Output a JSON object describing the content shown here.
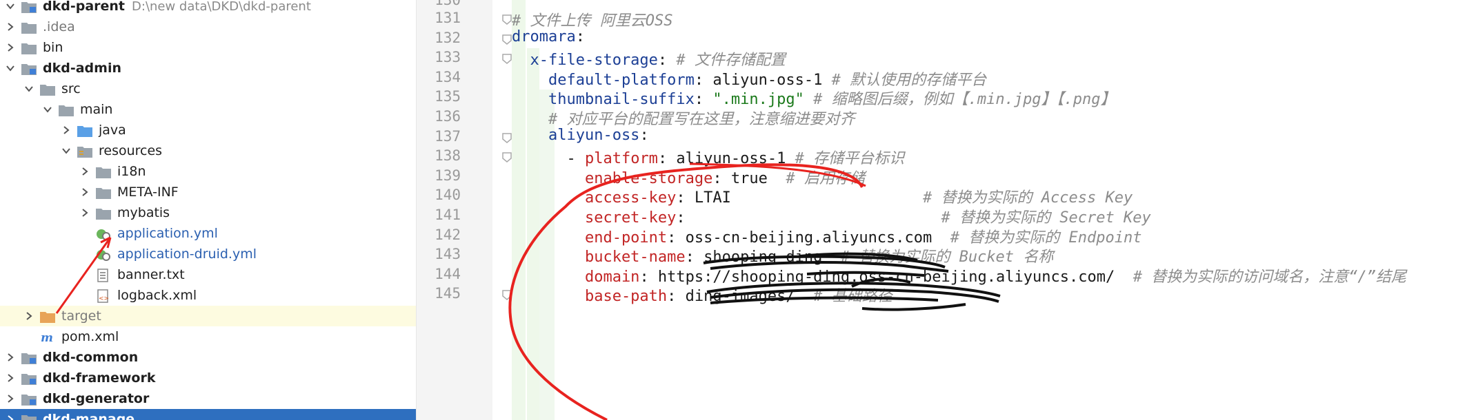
{
  "tree": {
    "root_label": "dkd-parent",
    "root_path": "D:\\new data\\DKD\\dkd-parent",
    "items": [
      {
        "label": ".idea"
      },
      {
        "label": "bin"
      },
      {
        "label": "dkd-admin"
      },
      {
        "label": "src"
      },
      {
        "label": "main"
      },
      {
        "label": "java"
      },
      {
        "label": "resources"
      },
      {
        "label": "i18n"
      },
      {
        "label": "META-INF"
      },
      {
        "label": "mybatis"
      },
      {
        "label": "application.yml"
      },
      {
        "label": "application-druid.yml"
      },
      {
        "label": "banner.txt"
      },
      {
        "label": "logback.xml"
      },
      {
        "label": "target"
      },
      {
        "label": "pom.xml"
      },
      {
        "label": "dkd-common"
      },
      {
        "label": "dkd-framework"
      },
      {
        "label": "dkd-generator"
      },
      {
        "label": "dkd-manage"
      }
    ]
  },
  "editor": {
    "partial_top_line": "130",
    "lines": [
      {
        "n": "131",
        "p": [
          {
            "t": "# 文件上传 阿里云OSS",
            "c": "cmt"
          }
        ]
      },
      {
        "n": "132",
        "p": [
          {
            "t": "dromara",
            "c": "navy"
          },
          {
            "t": ":",
            "c": ""
          }
        ]
      },
      {
        "n": "133",
        "p": [
          {
            "t": "  x-file-storage",
            "c": "navy"
          },
          {
            "t": ": ",
            "c": ""
          },
          {
            "t": "# 文件存储配置",
            "c": "cmt"
          }
        ]
      },
      {
        "n": "134",
        "p": [
          {
            "t": "    default-platform",
            "c": "navy"
          },
          {
            "t": ": aliyun-oss-1 ",
            "c": ""
          },
          {
            "t": "# 默认使用的存储平台",
            "c": "cmt"
          }
        ]
      },
      {
        "n": "135",
        "p": [
          {
            "t": "    thumbnail-suffix",
            "c": "navy"
          },
          {
            "t": ": ",
            "c": ""
          },
          {
            "t": "\".min.jpg\"",
            "c": "green"
          },
          {
            "t": " # 缩略图后缀，例如【.min.jpg】【.png】",
            "c": "cmt"
          }
        ]
      },
      {
        "n": "136",
        "p": [
          {
            "t": "    # 对应平台的配置写在这里，注意缩进要对齐",
            "c": "cmt"
          }
        ]
      },
      {
        "n": "137",
        "p": [
          {
            "t": "    aliyun-oss",
            "c": "navy"
          },
          {
            "t": ":",
            "c": ""
          }
        ]
      },
      {
        "n": "138",
        "p": [
          {
            "t": "      - ",
            "c": ""
          },
          {
            "t": "platform",
            "c": "red"
          },
          {
            "t": ": aliyun-oss-1 ",
            "c": ""
          },
          {
            "t": "# 存储平台标识",
            "c": "cmt"
          }
        ]
      },
      {
        "n": "139",
        "p": [
          {
            "t": "        enable-storage",
            "c": "red"
          },
          {
            "t": ": true  ",
            "c": ""
          },
          {
            "t": "# 启用存储",
            "c": "cmt"
          }
        ]
      },
      {
        "n": "140",
        "p": [
          {
            "t": "        access-key",
            "c": "red"
          },
          {
            "t": ": LTAI                     ",
            "c": ""
          },
          {
            "t": "# 替换为实际的 Access Key",
            "c": "cmt"
          }
        ]
      },
      {
        "n": "141",
        "p": [
          {
            "t": "        secret-key",
            "c": "red"
          },
          {
            "t": ":                            ",
            "c": ""
          },
          {
            "t": "# 替换为实际的 Secret Key",
            "c": "cmt"
          }
        ]
      },
      {
        "n": "142",
        "p": [
          {
            "t": "        end-point",
            "c": "red"
          },
          {
            "t": ": oss-cn-beijing.aliyuncs.com  ",
            "c": ""
          },
          {
            "t": "# 替换为实际的 Endpoint",
            "c": "cmt"
          }
        ]
      },
      {
        "n": "143",
        "p": [
          {
            "t": "        bucket-name",
            "c": "red"
          },
          {
            "t": ": shooping-ding  ",
            "c": ""
          },
          {
            "t": "# 替换为实际的 Bucket 名称",
            "c": "cmt"
          }
        ]
      },
      {
        "n": "144",
        "p": [
          {
            "t": "        domain",
            "c": "red"
          },
          {
            "t": ": https://shooping-ding.oss-cn-beijing.aliyuncs.com/  ",
            "c": ""
          },
          {
            "t": "# 替换为实际的访问域名，注意“/”结尾",
            "c": "cmt"
          }
        ]
      },
      {
        "n": "145",
        "p": [
          {
            "t": "        base-path",
            "c": "red"
          },
          {
            "t": ": ding-images/  ",
            "c": ""
          },
          {
            "t": "# 基础路径",
            "c": "cmt"
          }
        ]
      }
    ]
  },
  "colors": {
    "navy": "#1c3f95",
    "red": "#c22525",
    "green": "#1c7a1c",
    "comment": "#8c8c8c",
    "annotation": "#e8231f"
  }
}
